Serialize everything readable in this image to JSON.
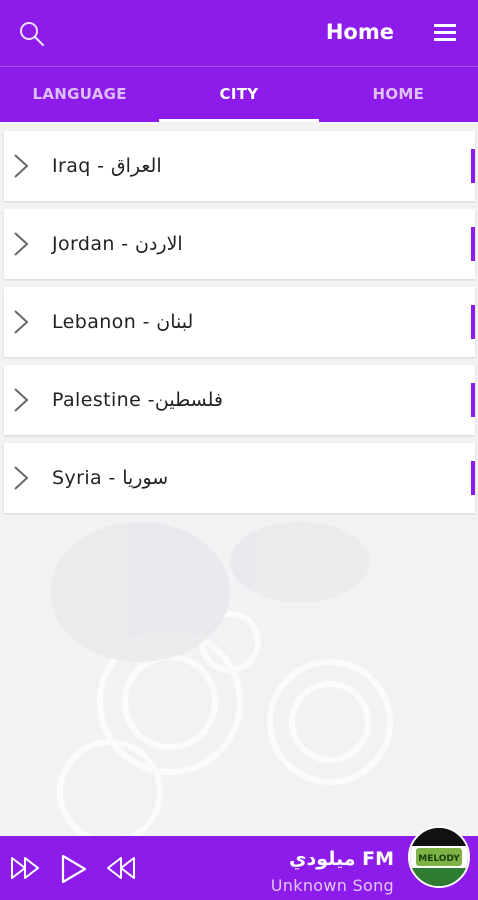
{
  "header": {
    "title": "Home",
    "search_icon": "search-icon",
    "menu_icon": "hamburger-menu-icon"
  },
  "tabs": [
    {
      "label": "LANGUAGE",
      "active": false
    },
    {
      "label": "CITY",
      "active": true
    },
    {
      "label": "HOME",
      "active": false
    }
  ],
  "cities": [
    {
      "label": "Iraq - العراق"
    },
    {
      "label": "Jordan - الاردن"
    },
    {
      "label": "Lebanon - لبنان"
    },
    {
      "label": "Palestine -فلسطين"
    },
    {
      "label": "Syria - سوريا"
    }
  ],
  "player": {
    "station": "ميلودي FM",
    "song": "Unknown Song",
    "controls": [
      "fast-forward-icon",
      "play-icon",
      "rewind-icon"
    ],
    "logo_text": "MELODY"
  },
  "colors": {
    "primary": "#8d1cea",
    "accent": "#8d1cea",
    "surface": "#ffffff"
  }
}
